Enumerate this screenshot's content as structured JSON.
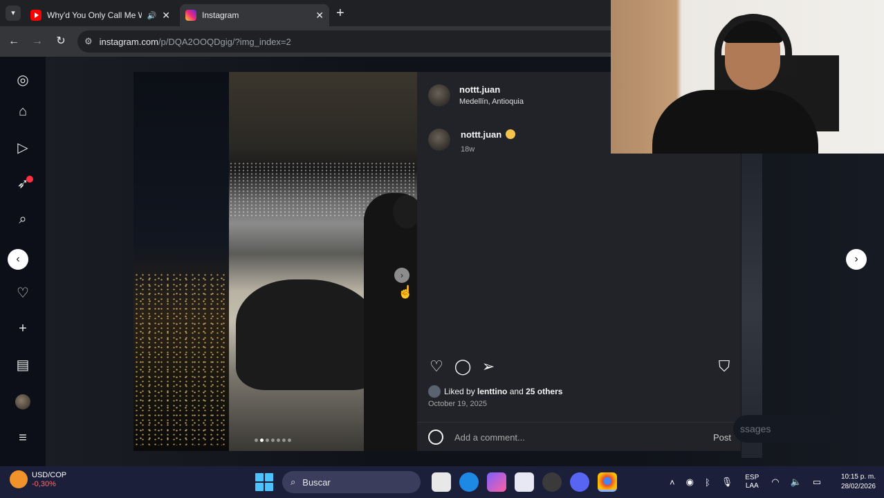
{
  "browser": {
    "tabs": [
      {
        "title": "Why'd You Only Call Me W"
      },
      {
        "title": "Instagram"
      }
    ],
    "url_host": "instagram.com",
    "url_path": "/p/DQA2OOQDgig/?img_index=2"
  },
  "post": {
    "username": "nottt.juan",
    "location": "Medellín, Antioquia",
    "caption_username": "nottt.juan",
    "age": "18w",
    "liked_by_prefix": "Liked by",
    "liked_by_user": "lenttino",
    "liked_by_joiner": "and",
    "liked_by_others": "25 others",
    "date": "October 19, 2025",
    "comment_placeholder": "Add a comment...",
    "post_label": "Post",
    "carousel_index": 2,
    "carousel_count": 7
  },
  "messages_pill": "ssages",
  "taskbar": {
    "widget_title": "USD/COP",
    "widget_change": "-0,30%",
    "search_label": "Buscar",
    "lang_line1": "ESP",
    "lang_line2": "LAA",
    "time": "10:15 p. m.",
    "date": "28/02/2026"
  },
  "icons": [
    "instagram-logo",
    "home",
    "reels",
    "explore",
    "search",
    "messenger",
    "heart",
    "create",
    "dashboard",
    "profile",
    "menu"
  ]
}
